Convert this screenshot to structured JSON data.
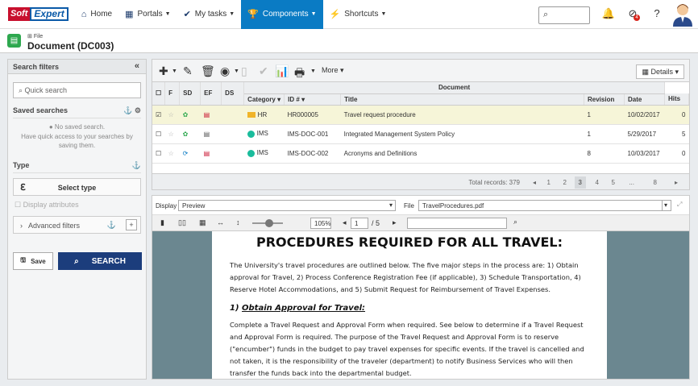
{
  "nav": {
    "logo_soft": "Soft",
    "logo_expert": "Expert",
    "home": "Home",
    "portals": "Portals",
    "mytasks": "My tasks",
    "components": "Components",
    "shortcuts": "Shortcuts",
    "notification_count": "4"
  },
  "doc": {
    "type": "File",
    "title": "Document (DC003)"
  },
  "left": {
    "header": "Search filters",
    "quick_search": "Quick search",
    "saved_searches": "Saved searches",
    "no_saved": "No saved search.",
    "have_quick": "Have quick access to your searches by saving them.",
    "type": "Type",
    "select_type": "Select type",
    "display_attributes": "Display attributes",
    "advanced_filters": "Advanced filters",
    "save": "Save",
    "search": "SEARCH"
  },
  "toolbar": {
    "more": "More",
    "details": "Details"
  },
  "table": {
    "group_header": "Document",
    "columns": [
      "F",
      "SD",
      "EF",
      "DS",
      "Category",
      "ID #",
      "Title",
      "Revision",
      "Date",
      "Hits"
    ],
    "rows": [
      {
        "category": "HR",
        "id": "HR000005",
        "title": "Travel request procedure",
        "revision": "1",
        "date": "10/02/2017",
        "hits": "0"
      },
      {
        "category": "IMS",
        "id": "IMS-DOC-001",
        "title": "Integrated Management System Policy",
        "revision": "1",
        "date": "5/29/2017",
        "hits": "5"
      },
      {
        "category": "IMS",
        "id": "IMS-DOC-002",
        "title": "Acronyms and Definitions",
        "revision": "8",
        "date": "10/03/2017",
        "hits": "0"
      }
    ],
    "total": "Total records: 379",
    "pages": [
      "1",
      "2",
      "3",
      "4",
      "5",
      "...",
      "8"
    ]
  },
  "preview": {
    "display_label": "Display",
    "display_value": "Preview",
    "file_label": "File",
    "file_value": "TravelProcedures.pdf",
    "zoom": "105%",
    "page": "1",
    "page_total": "/ 5",
    "doc_title": "PROCEDURES REQUIRED FOR ALL TRAVEL:",
    "para1": "The University's travel procedures are outlined below. The five major steps in the process are: 1) Obtain approval for Travel, 2) Process Conference Registration Fee (if applicable), 3) Schedule Transportation, 4) Reserve Hotel Accommodations, and 5) Submit Request for Reimbursement of Travel Expenses.",
    "step_num": "1)",
    "step_title": "Obtain Approval for Travel:",
    "para2": "Complete a Travel Request and Approval Form when required. See below to determine if a Travel Request and Approval Form is required. The purpose of the Travel Request and Approval Form is to reserve (\"encumber\") funds in the budget to pay travel expenses for specific events. If the travel is cancelled and not taken, it is the responsibility of the traveler (department) to notify Business Services who will then transfer the funds back into the departmental budget."
  }
}
